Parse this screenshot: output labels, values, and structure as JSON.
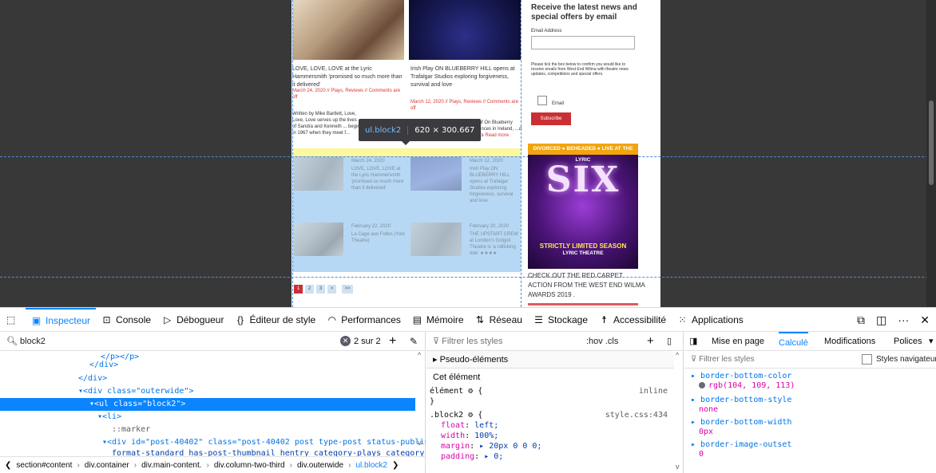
{
  "page": {
    "newsletter": {
      "title": "Receive the latest news and special offers by email",
      "email_label": "Email Address",
      "consent_text": "Please tick the box below to confirm you would like to receive emails from West End Wilma with theatre news updates, competitions and special offers.",
      "checkbox_label": "Email",
      "subscribe_label": "Subscribe"
    },
    "posts": [
      {
        "title": "LOVE, LOVE, LOVE at the Lyric Hammersmith 'promised so much more than it delivered'",
        "meta": "March 24, 2020 // Plays, Reviews // Comments are off",
        "excerpt": "Written by Mike Bartlett, Love, Love, Love serves up the lives of Sandra and Kenneth ... begin in 1967 when they meet f..."
      },
      {
        "title": "Irish Play ON BLUEBERRY HILL opens at Trafalgar Studios exploring forgiveness, survival and love",
        "meta": "March 12, 2020 // Plays, Reviews // Comments are off",
        "excerpt": "...2 production of On Blueberry ...seen by audiences in Ireland, ...d is now making its",
        "read_more": "Read more"
      }
    ],
    "faded_posts": [
      {
        "date": "March 24, 2020",
        "title": "LOVE, LOVE, LOVE at the Lyric Hammersmith 'promised so much more than it delivered'"
      },
      {
        "date": "March 12, 2020",
        "title": "Irish Play ON BLUEBERRY HILL opens at Trafalgar Studios exploring forgiveness, survival and love"
      },
      {
        "date": "February 22, 2020",
        "title": "La Cage aux Folles (York Theatre)"
      },
      {
        "date": "February 20, 2020",
        "title": "THE UPSTART CREW at London's Golgoli Theatre is 'a rollicking ride' ★★★★"
      }
    ],
    "pager": [
      "1",
      "2",
      "3",
      ">",
      ">>"
    ],
    "ad": {
      "banner_left": "DIVORCED",
      "banner_mid": "BEHEADED",
      "banner_right": "LIVE AT THE LYRIC",
      "logo": "SIX",
      "strip": "STRICTLY LIMITED SEASON",
      "venue": "LYRIC THEATRE"
    },
    "carpet_text": "CHECK OUT THE RED CARPET ACTION FROM THE WEST END WILMA AWARDS 2019 ."
  },
  "highlighter": {
    "selector": "ul.block2",
    "dimensions": "620 × 300.667"
  },
  "devtools": {
    "tabs": [
      {
        "label": "Inspecteur",
        "icon": "inspector-icon"
      },
      {
        "label": "Console",
        "icon": "console-icon"
      },
      {
        "label": "Débogueur",
        "icon": "debugger-icon"
      },
      {
        "label": "Éditeur de style",
        "icon": "style-editor-icon"
      },
      {
        "label": "Performances",
        "icon": "performance-icon"
      },
      {
        "label": "Mémoire",
        "icon": "memory-icon"
      },
      {
        "label": "Réseau",
        "icon": "network-icon"
      },
      {
        "label": "Stockage",
        "icon": "storage-icon"
      },
      {
        "label": "Accessibilité",
        "icon": "accessibility-icon"
      },
      {
        "label": "Applications",
        "icon": "applications-icon"
      }
    ],
    "search": {
      "query": "block2",
      "count": "2 sur 2"
    },
    "markup_lines": [
      {
        "text": "</p></p>",
        "indent": 9
      },
      {
        "text": "</div>",
        "indent": 8
      },
      {
        "text": "</div>",
        "indent": 7
      },
      {
        "text": "▾<div class=\"outerwide\">",
        "indent": 7
      },
      {
        "text": "▾<ul class=\"block2\">",
        "indent": 8,
        "selected": true
      },
      {
        "text": "▾<li>",
        "indent": 9
      },
      {
        "text": "::marker",
        "indent": 11
      },
      {
        "text": "▾<div id=\"post-40402\" class=\"post-40402 post type-post status-publish",
        "indent": 10
      },
      {
        "text": "format-standard has-post-thumbnail hentry category-plays category-",
        "indent": 10
      }
    ],
    "breadcrumbs": [
      "section#content",
      "div.container",
      "div.main-content.",
      "div.column-two-third",
      "div.outerwide",
      "ul.block2"
    ],
    "rules": {
      "filter_placeholder": "Filtrer les styles",
      "options": ":hov  .cls",
      "pseudo": "Pseudo-éléments",
      "this_element": "Cet élément",
      "element_rule": "élément ⚙ {",
      "element_src": "inline",
      "close": "}",
      "block_rule": ".block2 ⚙ {",
      "block_src": "style.css:434",
      "decls": [
        {
          "prop": "float",
          "value": "left;"
        },
        {
          "prop": "width",
          "value": "100%;"
        },
        {
          "prop": "margin",
          "value": "▸ 20px 0 0 0;"
        },
        {
          "prop": "padding",
          "value": "▸ 0;"
        }
      ]
    },
    "computed": {
      "tabs": [
        "Mise en page",
        "Calculé",
        "Modifications",
        "Polices"
      ],
      "active_tab": "Calculé",
      "filter_placeholder": "Filtrer les styles",
      "browser_styles": "Styles navigateur",
      "props": [
        {
          "name": "border-bottom-color",
          "value": "rgb(104, 109, 113)",
          "swatch": "#686d71"
        },
        {
          "name": "border-bottom-style",
          "value": "none"
        },
        {
          "name": "border-bottom-width",
          "value": "0px"
        },
        {
          "name": "border-image-outset",
          "value": "0"
        }
      ]
    }
  }
}
